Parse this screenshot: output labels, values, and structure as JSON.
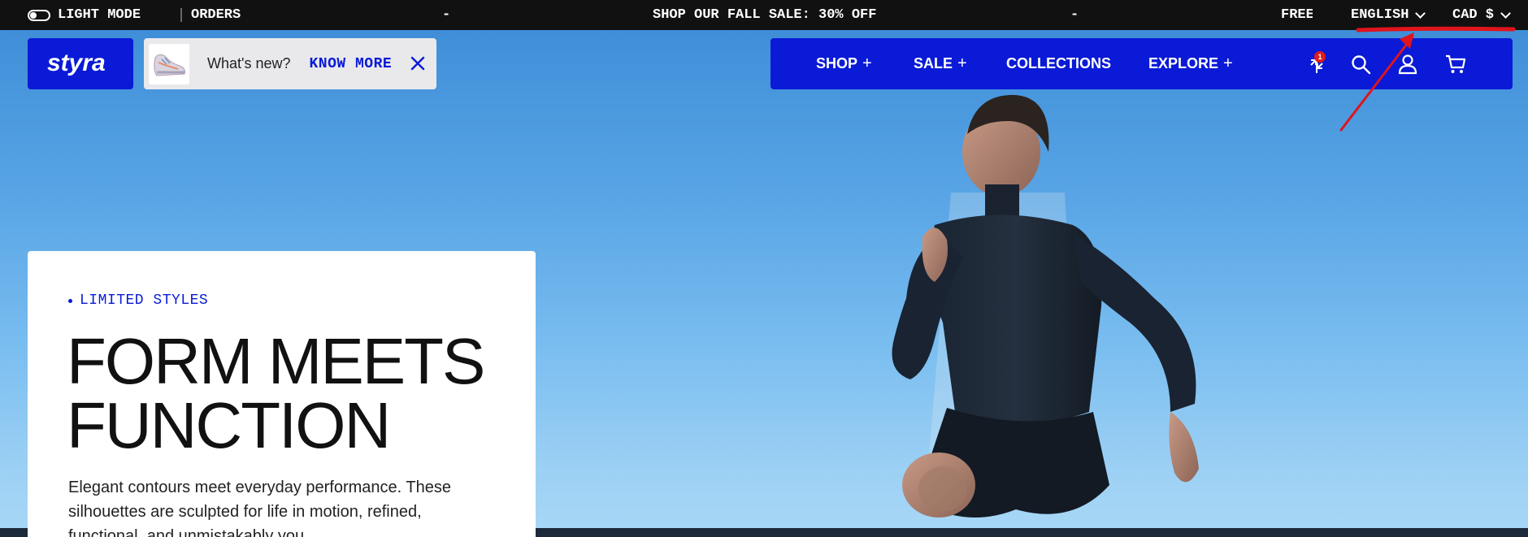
{
  "topbar": {
    "light_mode_label": "LIGHT MODE",
    "orders_label": "ORDERS",
    "dash_left": "-",
    "promo": "SHOP OUR FALL SALE: 30% OFF",
    "dash_right": "-",
    "free_label": "FREE",
    "language": "ENGLISH",
    "currency": "CAD $"
  },
  "header": {
    "logo_text": "styra",
    "whats_new": "What's new?",
    "know_more": "KNOW MORE",
    "nav": [
      {
        "label": "SHOP",
        "has_submenu": true
      },
      {
        "label": "SALE",
        "has_submenu": true
      },
      {
        "label": "COLLECTIONS",
        "has_submenu": false
      },
      {
        "label": "EXPLORE",
        "has_submenu": true
      }
    ],
    "plus_symbol": "+",
    "compare_badge": "1",
    "icons": [
      "compare-icon",
      "search-icon",
      "account-icon",
      "cart-icon"
    ]
  },
  "hero": {
    "eyebrow": "LIMITED STYLES",
    "headline_line1": "FORM MEETS",
    "headline_line2": "FUNCTION",
    "body": "Elegant contours meet everyday performance. These silhouettes are sculpted for life in motion, refined, functional, and unmistakably you."
  },
  "colors": {
    "brand_blue": "#0a1ad6",
    "topbar_bg": "#111111",
    "annotation_red": "#e0141c",
    "badge_red": "#e21b1b"
  }
}
